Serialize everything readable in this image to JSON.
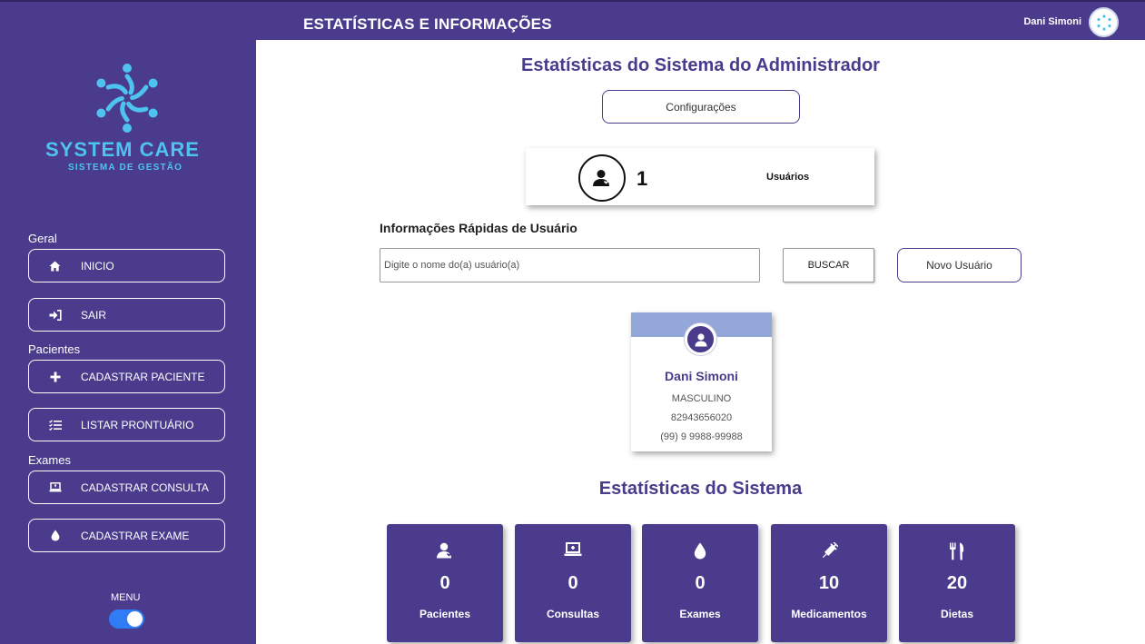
{
  "topbar": {
    "title": "ESTATÍSTICAS E INFORMAÇÕES",
    "user_name": "Dani Simoni",
    "avatar_icon": "system-care-logo-icon"
  },
  "brand": {
    "name": "SYSTEM CARE",
    "tagline": "SISTEMA DE GESTÃO",
    "color": "#4ec3f0"
  },
  "sidebar": {
    "sections": {
      "geral": "Geral",
      "pacientes": "Pacientes",
      "exames": "Exames"
    },
    "items": [
      {
        "label": "INICIO",
        "icon": "home-icon"
      },
      {
        "label": "SAIR",
        "icon": "sign-out-icon"
      },
      {
        "label": "CADASTRAR PACIENTE",
        "icon": "plus-icon"
      },
      {
        "label": "LISTAR PRONTUÁRIO",
        "icon": "list-icon"
      },
      {
        "label": "CADASTRAR CONSULTA",
        "icon": "laptop-icon"
      },
      {
        "label": "CADASTRAR EXAME",
        "icon": "drop-icon"
      }
    ],
    "menu_label": "MENU",
    "menu_toggle_on": true
  },
  "main": {
    "title": "Estatísticas do Sistema do Administrador",
    "config_button": "Configurações",
    "users_card": {
      "count": "1",
      "label": "Usuários",
      "icon": "user-icon"
    },
    "quick_info_title": "Informações Rápidas de Usuário",
    "search": {
      "placeholder": "Digite o nome do(a) usuário(a)",
      "value": ""
    },
    "buscar_button": "BUSCAR",
    "new_user_button": "Novo Usuário",
    "user_card": {
      "name": "Dani Simoni",
      "gender": "MASCULINO",
      "document": "82943656020",
      "phone": "(99) 9 9988-99988"
    },
    "system_stats_title": "Estatísticas do Sistema",
    "stats": [
      {
        "value": "0",
        "label": "Pacientes",
        "icon": "patient-icon"
      },
      {
        "value": "0",
        "label": "Consultas",
        "icon": "laptop-medical-icon"
      },
      {
        "value": "0",
        "label": "Exames",
        "icon": "drop-icon"
      },
      {
        "value": "10",
        "label": "Medicamentos",
        "icon": "syringe-icon"
      },
      {
        "value": "20",
        "label": "Dietas",
        "icon": "utensils-icon"
      }
    ]
  },
  "colors": {
    "primary": "#4a3b8c",
    "banner": "#93a8d8",
    "toggle": "#2f7cf6"
  }
}
